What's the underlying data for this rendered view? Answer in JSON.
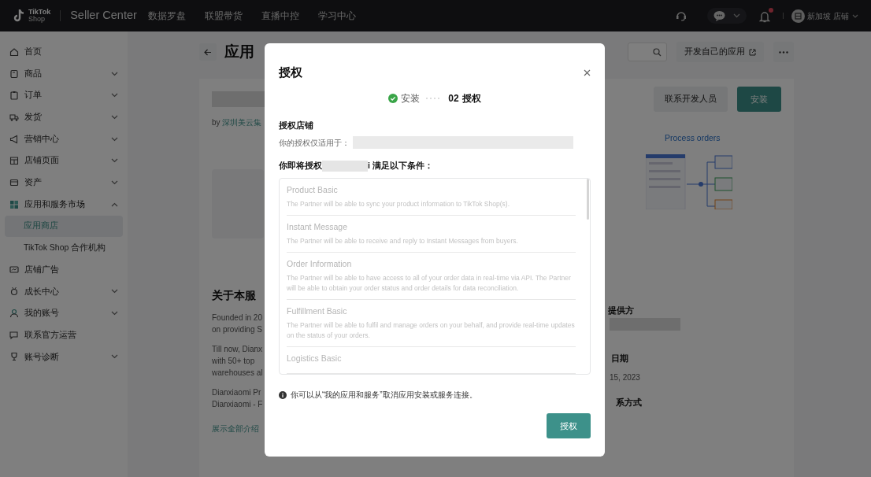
{
  "navbar": {
    "logo_lines": [
      "TikTok",
      "Shop"
    ],
    "product": "Seller Center",
    "menu": [
      "数据罗盘",
      "联盟带货",
      "直播中控",
      "学习中心"
    ],
    "has_notification": true,
    "account": "新加坡 店铺"
  },
  "sidebar": {
    "items": [
      {
        "label": "首页"
      },
      {
        "label": "商品",
        "expanded": false
      },
      {
        "label": "订单",
        "expanded": false
      },
      {
        "label": "发货",
        "expanded": false
      },
      {
        "label": "营销中心",
        "expanded": false
      },
      {
        "label": "店铺页面",
        "expanded": false
      },
      {
        "label": "资产",
        "expanded": false
      },
      {
        "label": "应用和服务市场",
        "expanded": true,
        "children": [
          {
            "label": "应用商店",
            "selected": true
          },
          {
            "label": "TikTok Shop 合作机构",
            "selected": false
          }
        ]
      },
      {
        "label": "店铺广告"
      },
      {
        "label": "成长中心",
        "expanded": false
      },
      {
        "label": "我的账号",
        "expanded": false
      },
      {
        "label": "联系官方运营"
      },
      {
        "label": "账号诊断",
        "expanded": false
      }
    ]
  },
  "page": {
    "title": "应用",
    "develop_button": "开发自己的应用"
  },
  "app": {
    "by": "by",
    "developer": "深圳美云集",
    "contact_button": "联系开发人员",
    "install_button": "安装",
    "feature_title": "Process orders"
  },
  "about": {
    "title": "关于本服",
    "paragraphs": [
      [
        "Founded in 20",
        "on providing S"
      ],
      [
        "Till now, Dianx",
        "with 50+ top",
        "warehouses al"
      ],
      [
        "Dianxiaomi Pr",
        "Dianxiaomi - F"
      ]
    ],
    "show_all": "展示全部介绍"
  },
  "details": {
    "provider_title": "提供方",
    "date_title": "日期",
    "date": "15, 2023",
    "contact_title": "系方式"
  },
  "dialog": {
    "title": "授权",
    "steps": [
      {
        "label": "安装",
        "done": true
      },
      {
        "number": "02",
        "label": "授权",
        "done": false
      }
    ],
    "shop_heading": "授权店铺",
    "shop_text": "你的授权仅适用于：",
    "scope_prefix": "你即将授权",
    "scope_suffix": "i 满足以下条件：",
    "permissions": [
      {
        "title": "Product Basic",
        "description": "The Partner will be able to sync your product information to TikTok Shop(s)."
      },
      {
        "title": "Instant Message",
        "description": "The Partner will be able to receive and reply to Instant Messages from buyers."
      },
      {
        "title": "Order Information",
        "description": "The Partner will be able to have access to all of your order data in real-time via API. The Partner will be able to obtain your order status and order details for data reconciliation."
      },
      {
        "title": "Fulfillment Basic",
        "description": "The Partner will be able to fulfil and manage orders on your behalf, and provide real-time updates on the status of your orders."
      },
      {
        "title": "Logistics Basic"
      }
    ],
    "note": "你可以从“我的应用和服务”取消应用安装或服务连接。",
    "confirm_button": "授权"
  }
}
